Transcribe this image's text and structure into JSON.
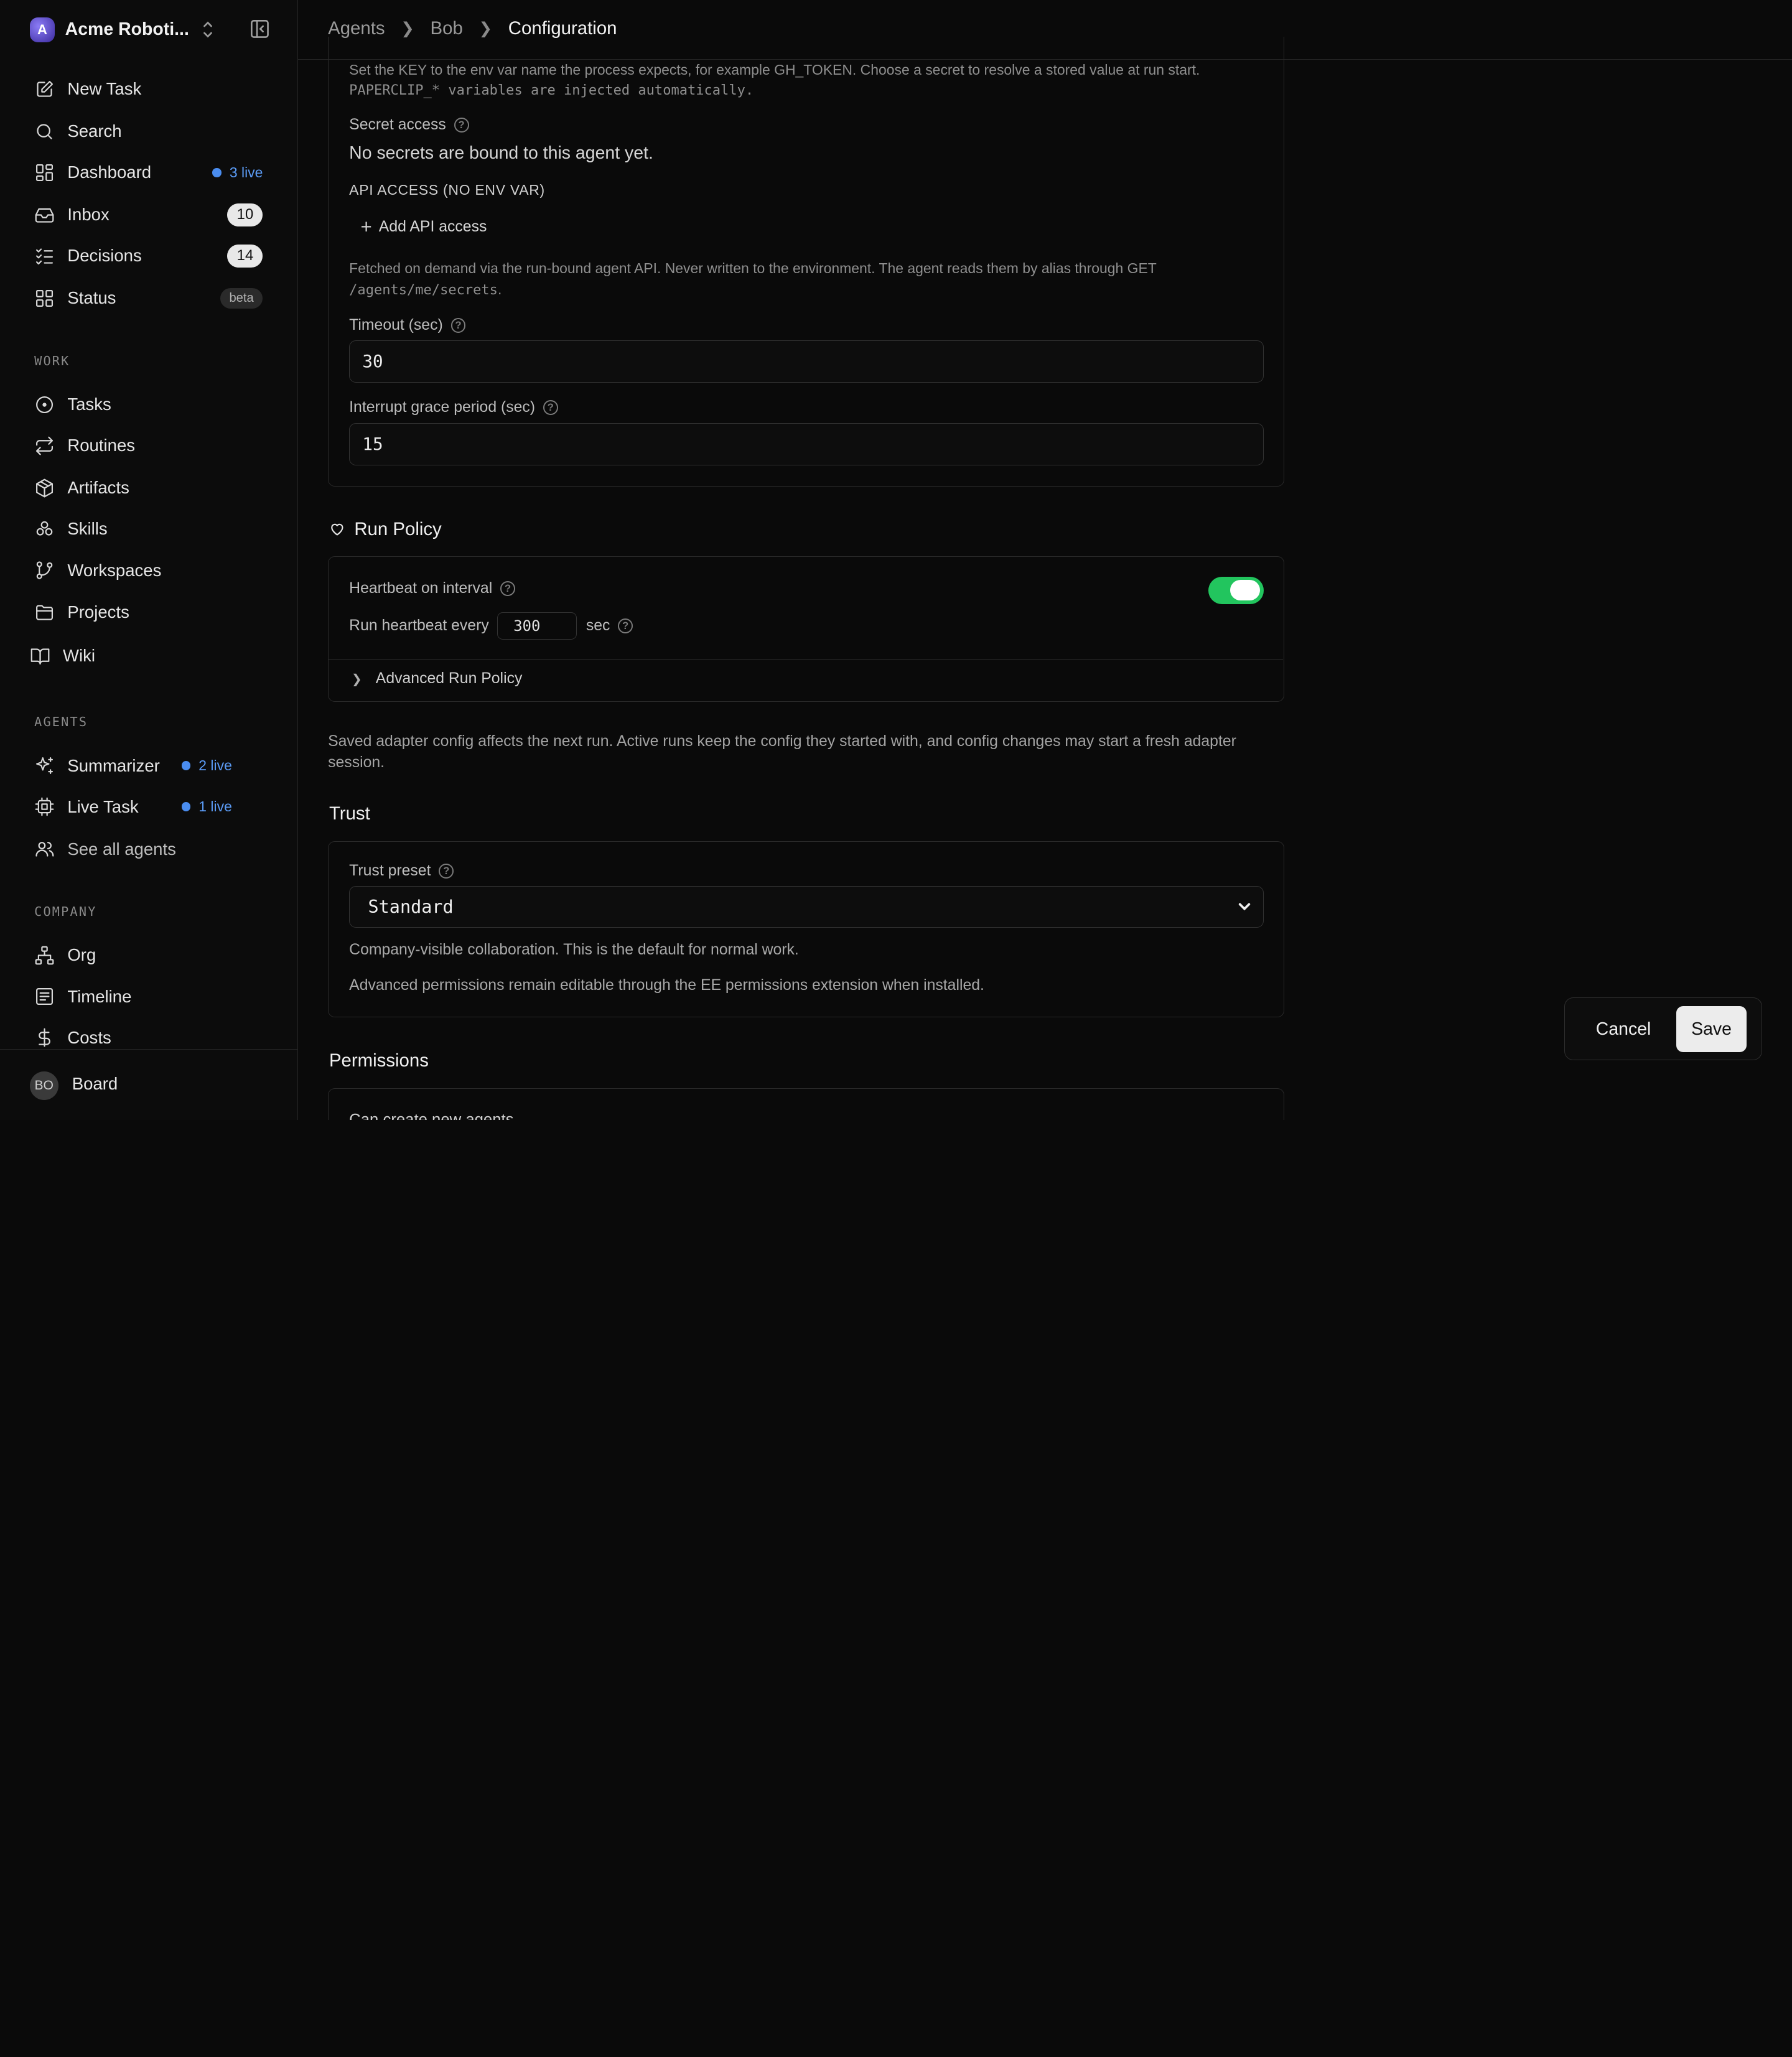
{
  "brand": {
    "initial": "A",
    "name": "Acme Roboti..."
  },
  "nav_main": [
    {
      "label": "New Task",
      "icon": "edit-icon"
    },
    {
      "label": "Search",
      "icon": "search-icon"
    },
    {
      "label": "Dashboard",
      "icon": "dashboard-icon",
      "live": "3 live"
    },
    {
      "label": "Inbox",
      "icon": "inbox-icon",
      "count": "10"
    },
    {
      "label": "Decisions",
      "icon": "checklist-icon",
      "count": "14"
    },
    {
      "label": "Status",
      "icon": "grid-icon",
      "badge": "beta"
    }
  ],
  "sections": {
    "work": "WORK",
    "agents": "AGENTS",
    "company": "COMPANY"
  },
  "nav_work": [
    "Tasks",
    "Routines",
    "Artifacts",
    "Skills",
    "Workspaces",
    "Projects",
    "Wiki"
  ],
  "nav_agents": [
    {
      "label": "Summarizer",
      "live": "2 live"
    },
    {
      "label": "Live Task",
      "live": "1 live"
    },
    {
      "label": "See all agents"
    }
  ],
  "nav_company": [
    "Org",
    "Timeline",
    "Costs"
  ],
  "user": {
    "initials": "BO",
    "name": "Board"
  },
  "breadcrumb": {
    "a": "Agents",
    "b": "Bob",
    "c": "Configuration"
  },
  "env": {
    "hint1": "Set the KEY to the env var name the process expects, for example GH_TOKEN. Choose a secret to resolve a stored value at run start.",
    "hint2": "PAPERCLIP_* variables are injected automatically.",
    "secret_label": "Secret access",
    "secret_empty": "No secrets are bound to this agent yet.",
    "api_heading": "API ACCESS (NO ENV VAR)",
    "add_api": "Add API access",
    "api_hint1": "Fetched on demand via the run-bound agent API. Never written to the environment. The agent reads them by alias through GET",
    "api_hint_path": "/agents/me/secrets",
    "api_hint_end": ".",
    "timeout_label": "Timeout (sec)",
    "timeout_value": "30",
    "grace_label": "Interrupt grace period (sec)",
    "grace_value": "15"
  },
  "run_policy": {
    "title": "Run Policy",
    "heartbeat_label": "Heartbeat on interval",
    "heartbeat_enabled": true,
    "every_label": "Run heartbeat every",
    "every_value": "300",
    "every_unit": "sec",
    "advanced": "Advanced Run Policy"
  },
  "note1": "Saved adapter config affects the next run. Active runs keep the config they started with, and config changes may start a fresh adapter",
  "note2": "session.",
  "trust": {
    "title": "Trust",
    "preset_label": "Trust preset",
    "preset_value": "Standard",
    "desc": "Company-visible collaboration. This is the default for normal work.",
    "adv": "Advanced permissions remain editable through the EE permissions extension when installed."
  },
  "permissions": {
    "title": "Permissions",
    "first_item": "Can create new agents"
  },
  "actions": {
    "cancel": "Cancel",
    "save": "Save"
  },
  "colors": {
    "toggle_on": "#22c55e",
    "live": "#4a8df0"
  }
}
